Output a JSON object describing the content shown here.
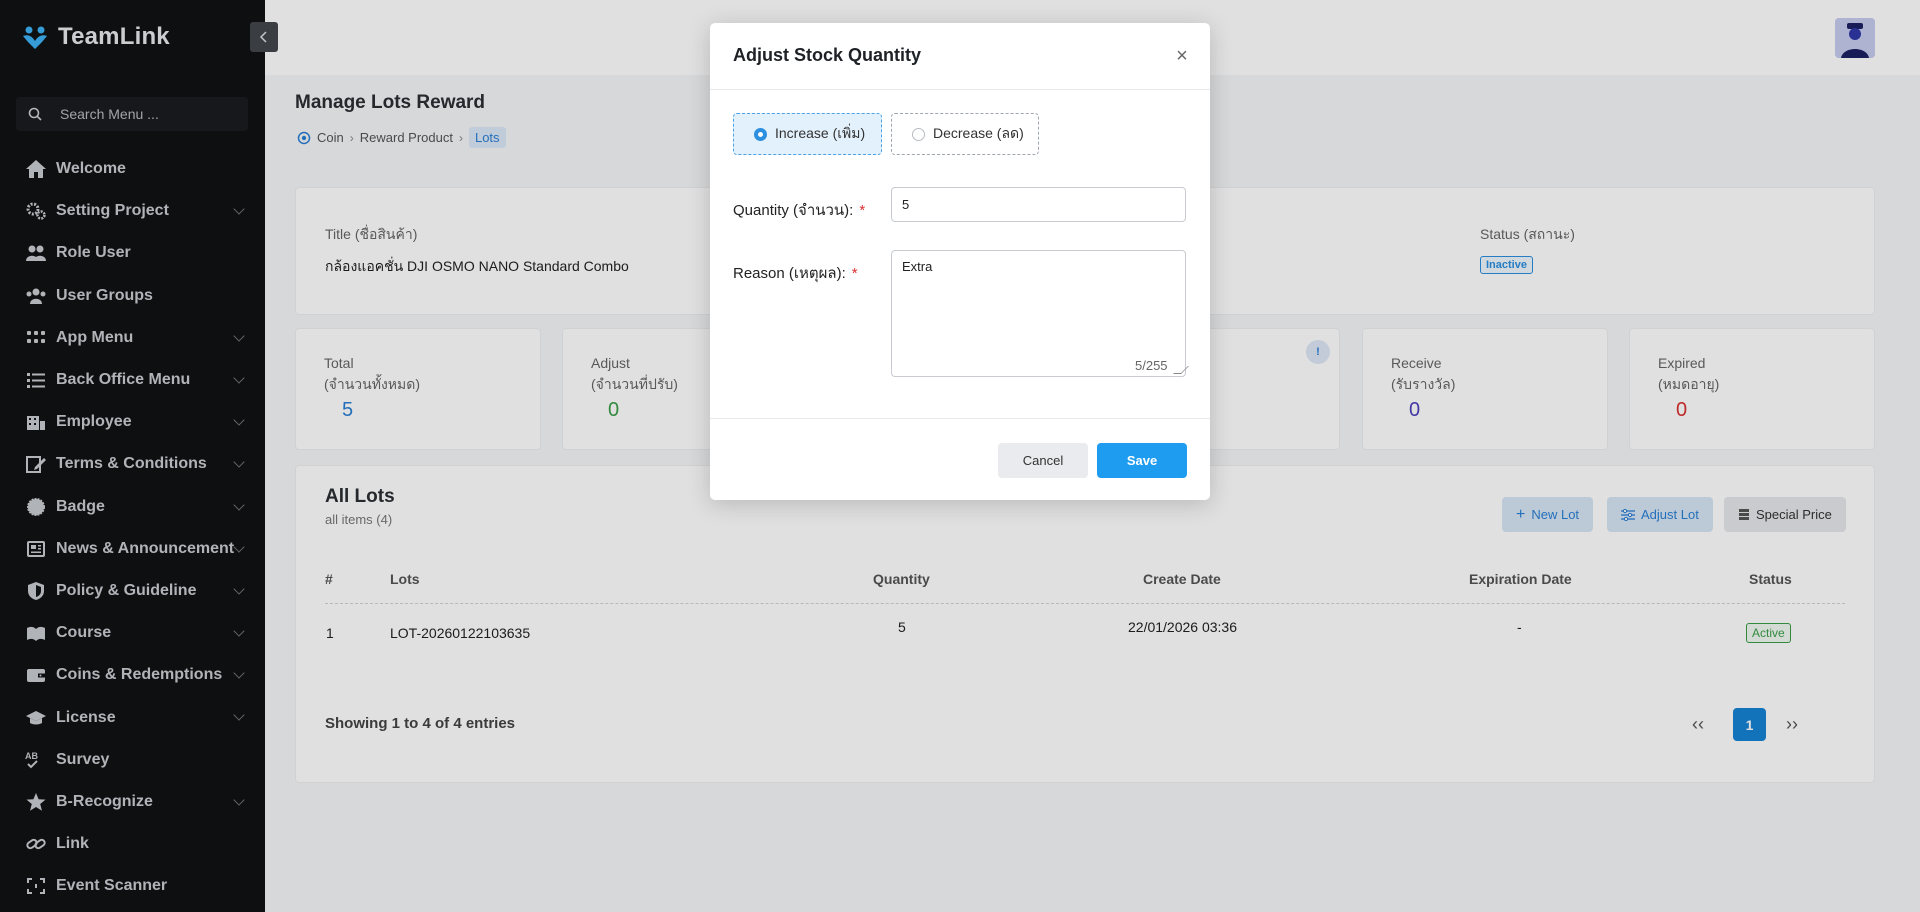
{
  "sidebar": {
    "brand": "TeamLink",
    "search_placeholder": "Search Menu ...",
    "items": [
      {
        "label": "Welcome",
        "icon": "home-icon",
        "expandable": false
      },
      {
        "label": "Setting Project",
        "icon": "gears-icon",
        "expandable": true
      },
      {
        "label": "Role User",
        "icon": "users-icon",
        "expandable": false
      },
      {
        "label": "User Groups",
        "icon": "user-group-icon",
        "expandable": false
      },
      {
        "label": "App Menu",
        "icon": "grid-icon",
        "expandable": true
      },
      {
        "label": "Back Office Menu",
        "icon": "list-icon",
        "expandable": true
      },
      {
        "label": "Employee",
        "icon": "employee-icon",
        "expandable": true
      },
      {
        "label": "Terms & Conditions",
        "icon": "edit-icon",
        "expandable": true
      },
      {
        "label": "Badge",
        "icon": "badge-icon",
        "expandable": true
      },
      {
        "label": "News & Announcement",
        "icon": "news-icon",
        "expandable": true
      },
      {
        "label": "Policy & Guideline",
        "icon": "shield-icon",
        "expandable": true
      },
      {
        "label": "Course",
        "icon": "course-icon",
        "expandable": true
      },
      {
        "label": "Coins & Redemptions",
        "icon": "wallet-icon",
        "expandable": true
      },
      {
        "label": "License",
        "icon": "graduation-cap-icon",
        "expandable": true
      },
      {
        "label": "Survey",
        "icon": "survey-icon",
        "expandable": false
      },
      {
        "label": "B-Recognize",
        "icon": "star-icon",
        "expandable": true
      },
      {
        "label": "Link",
        "icon": "link-icon",
        "expandable": false
      },
      {
        "label": "Event Scanner",
        "icon": "scan-icon",
        "expandable": false
      }
    ]
  },
  "page": {
    "title": "Manage Lots Reward",
    "breadcrumb": [
      "Coin",
      "Reward Product",
      "Lots"
    ]
  },
  "info": {
    "title_label": "Title (ชื่อสินค้า)",
    "title_value": "กล้องแอคชั่น DJI OSMO NANO Standard Combo",
    "status_label": "Status (สถานะ)",
    "status_value": "Inactive"
  },
  "stats": {
    "total_label1": "Total",
    "total_label2": "(จำนวนทั้งหมด)",
    "total_value": "5",
    "adjust_label1": "Adjust",
    "adjust_label2": "(จำนวนที่ปรับ)",
    "adjust_value": "0",
    "receive_label1": "Receive",
    "receive_label2": "(รับรางวัล)",
    "receive_value": "0",
    "expired_label1": "Expired",
    "expired_label2": "(หมดอายุ)",
    "expired_value": "0",
    "info_glyph": "!"
  },
  "lots": {
    "title": "All Lots",
    "subtitle": "all items (4)",
    "new_lot": "New Lot",
    "adjust_lot": "Adjust Lot",
    "special_price": "Special Price",
    "columns": [
      "#",
      "Lots",
      "Quantity",
      "Create Date",
      "Expiration Date",
      "Status"
    ],
    "rows": [
      {
        "no": "1",
        "lot": "LOT-20260122103635",
        "quantity": "5",
        "create_date": "22/01/2026 03:36",
        "expiration": "-",
        "status": "Active"
      }
    ],
    "showing": "Showing 1 to 4 of 4 entries",
    "current_page": "1",
    "prev": "‹‹",
    "next": "››"
  },
  "modal": {
    "title": "Adjust Stock Quantity",
    "close": "×",
    "increase_label": "Increase (เพิ่ม)",
    "decrease_label": "Decrease (ลด)",
    "quantity_label": "Quantity (จำนวน):",
    "quantity_value": "5",
    "reason_label": "Reason (เหตุผล):",
    "reason_value": "Extra",
    "char_count": "5/255",
    "required_mark": "*",
    "cancel": "Cancel",
    "save": "Save"
  },
  "colors": {
    "accent": "#1e9cf0",
    "sidebar_bg": "#111214",
    "active": "#3a9e48",
    "expired": "#d9302f",
    "receive": "#4b3fbd"
  }
}
